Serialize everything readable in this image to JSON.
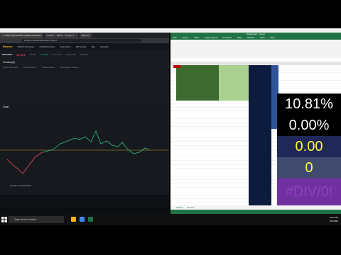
{
  "browser": {
    "tabs": [
      "↑ 1.72% (?) BTCUSDT | Binance Futures",
      "Pricelist – Tables – Google S…",
      "Binance"
    ],
    "url": "binance.com/en/futures/BTCUSDT",
    "nav": [
      "Binance",
      "USDⓈ-M Futures",
      "COIN-M Futures",
      "Information",
      "API Access",
      "Bps",
      "Activities"
    ],
    "ticker": {
      "symbol": "BTCUSDT",
      "price": "17,767",
      "fields": [
        "17,767",
        "71,4434",
        "17,777.37",
        "17,577.43",
        "1,117,53"
      ]
    },
    "positions_label": "Position(8)",
    "row2": [
      "Open Orders(0)",
      "Order History",
      "Trade History",
      "Transaction History"
    ],
    "chart_label": "Chart",
    "boost_label": "Check our Scoreboard",
    "chart_colors": {
      "line_up": "#0ecb81",
      "line_down": "#f6465d",
      "bg": "#161a1e"
    }
  },
  "excel": {
    "title": "Workbook1 – Excel",
    "menu": [
      "File",
      "Home",
      "Insert",
      "Page Layout",
      "Formulas",
      "Data",
      "Review",
      "View",
      "Help"
    ],
    "big_cells": [
      {
        "text": "10.81%",
        "bg": "#000000",
        "color": "#ffffff"
      },
      {
        "text": "0.00%",
        "bg": "#000000",
        "color": "#ffffff"
      },
      {
        "text": "0.00",
        "bg": "#1f2859",
        "color": "#ffff33"
      },
      {
        "text": "0",
        "bg": "#404a6e",
        "color": "#ffff33"
      },
      {
        "text": "#DIV/0!",
        "bg": "#7030a0",
        "color": "#9040c0"
      }
    ],
    "sheet_tabs": [
      "Sheet1",
      "Sheet2"
    ]
  },
  "taskbar": {
    "search_placeholder": "Type here to search",
    "time": "11:11 AM",
    "date": "8/1/2021"
  }
}
